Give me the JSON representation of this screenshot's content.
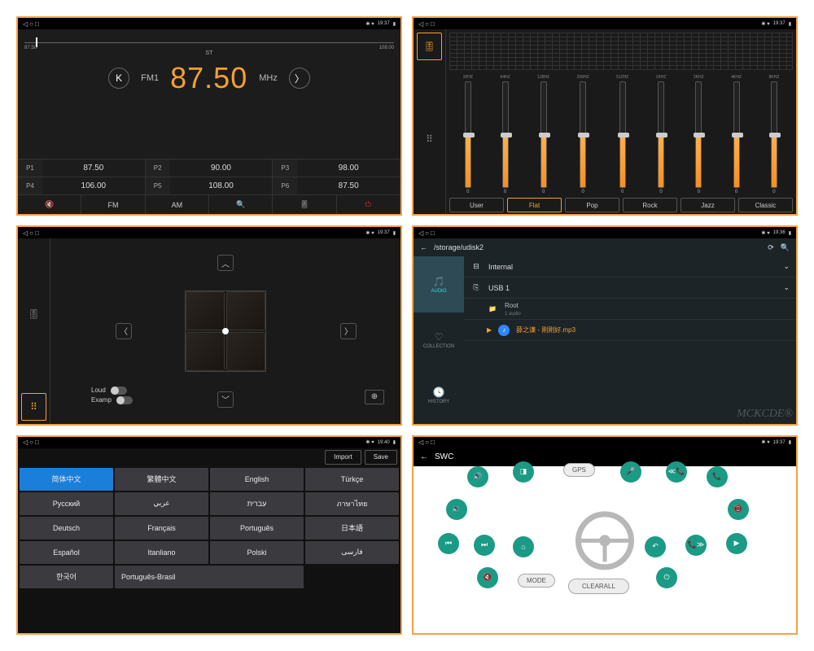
{
  "status": {
    "time_a": "19:37",
    "time_b": "19:36",
    "time_c": "19:40",
    "time_d": "19:37"
  },
  "radio": {
    "scale_left": "87.50",
    "scale_right": "108.00",
    "st": "ST",
    "band": "FM1",
    "freq": "87.50",
    "unit": "MHz",
    "presets": [
      {
        "p": "P1",
        "v": "87.50"
      },
      {
        "p": "P2",
        "v": "90.00"
      },
      {
        "p": "P3",
        "v": "98.00"
      },
      {
        "p": "P4",
        "v": "106.00"
      },
      {
        "p": "P5",
        "v": "108.00"
      },
      {
        "p": "P6",
        "v": "87.50"
      }
    ],
    "bottom": {
      "fm": "FM",
      "am": "AM"
    }
  },
  "eq": {
    "freqs": [
      "32HZ",
      "64HZ",
      "128HZ",
      "256HZ",
      "512HZ",
      "1KHZ",
      "2KHZ",
      "4KHZ",
      "8KHZ"
    ],
    "vals": [
      "0",
      "0",
      "0",
      "0",
      "0",
      "0",
      "0",
      "0",
      "0"
    ],
    "presets": [
      "User",
      "Flat",
      "Pop",
      "Rock",
      "Jazz",
      "Classic"
    ],
    "active_preset": 1
  },
  "balance": {
    "loud": "Loud",
    "examp": "Examp"
  },
  "files": {
    "path": "/storage/udisk2",
    "tabs": {
      "audio": "AUDIO",
      "collection": "COLLECTION",
      "history": "HISTORY"
    },
    "internal": "Internal",
    "usb": "USB 1",
    "root": "Root",
    "root_sub": "1 audio",
    "song": "薛之谦 - 刚刚好.mp3",
    "watermark": "MCKCDE®"
  },
  "lang": {
    "import": "Import",
    "save": "Save",
    "items": [
      "简体中文",
      "繁體中文",
      "English",
      "Türkçe",
      "Русский",
      "عربي",
      "עברית",
      "ภาษาไทย",
      "Deutsch",
      "Français",
      "Português",
      "日本語",
      "Español",
      "Itanliano",
      "Polski",
      "فارسی",
      "한국어",
      "Português-Brasil"
    ]
  },
  "swc": {
    "title": "SWC",
    "gps": "GPS",
    "mode": "MODE",
    "clearall": "CLEARALL"
  }
}
